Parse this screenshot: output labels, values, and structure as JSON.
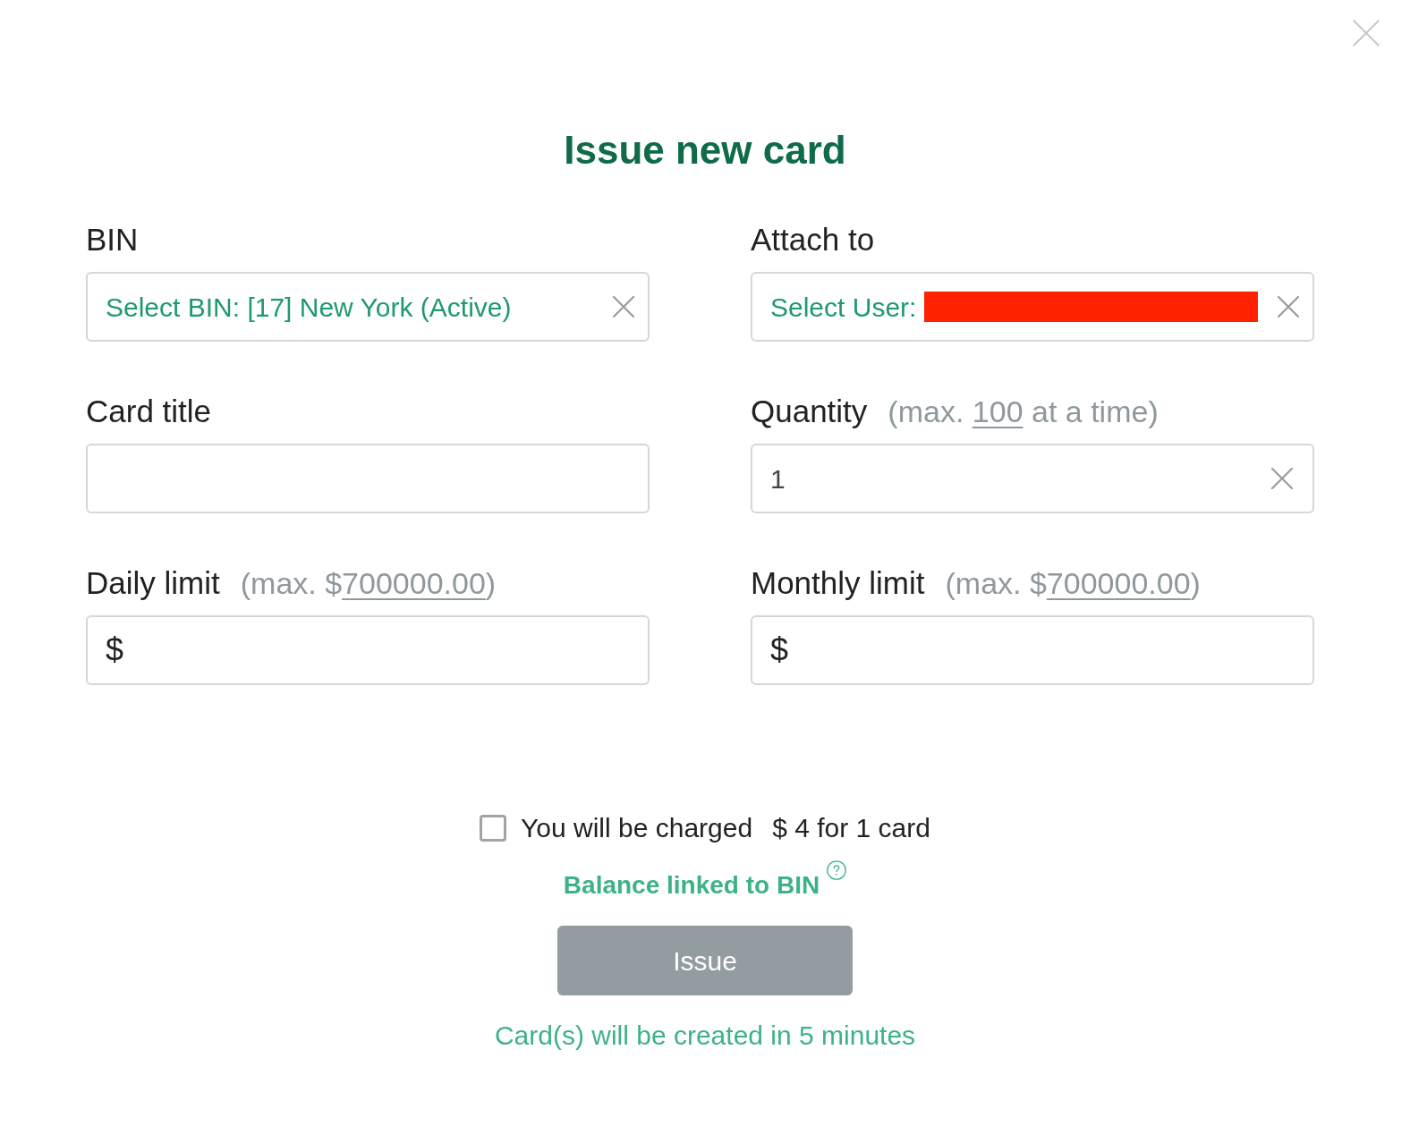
{
  "title": "Issue new card",
  "fields": [
    {
      "kind": "select",
      "label": "BIN",
      "value": "Select BIN: [17] New York (Active)",
      "redacted": false,
      "clearable": true
    },
    {
      "kind": "select",
      "label": "Attach to",
      "value": "Select User:",
      "redacted": true,
      "clearable": true
    },
    {
      "kind": "text",
      "label": "Card title"
    },
    {
      "kind": "number",
      "label": "Quantity",
      "hint": [
        {
          "kind": "text",
          "text": "(max. "
        },
        {
          "kind": "link",
          "text": "100"
        },
        {
          "kind": "text",
          "text": " at a time)"
        }
      ],
      "value": "1",
      "clearable": true
    },
    {
      "kind": "money",
      "label": "Daily limit",
      "hint": [
        {
          "kind": "text",
          "text": "(max. $"
        },
        {
          "kind": "link",
          "text": "700000.00"
        },
        {
          "kind": "text",
          "text": ")"
        }
      ],
      "prefix": "$"
    },
    {
      "kind": "money",
      "label": "Monthly limit",
      "hint": [
        {
          "kind": "text",
          "text": "(max. $"
        },
        {
          "kind": "link",
          "text": "700000.00"
        },
        {
          "kind": "text",
          "text": ")"
        }
      ],
      "prefix": "$"
    }
  ],
  "charge": {
    "checked": false,
    "label": "You will be charged",
    "amount": "$ 4 for 1 card"
  },
  "balance_note": "Balance linked to BIN",
  "issue_button": {
    "label": "Issue",
    "disabled": true
  },
  "footer_note": "Card(s) will be created in 5 minutes"
}
